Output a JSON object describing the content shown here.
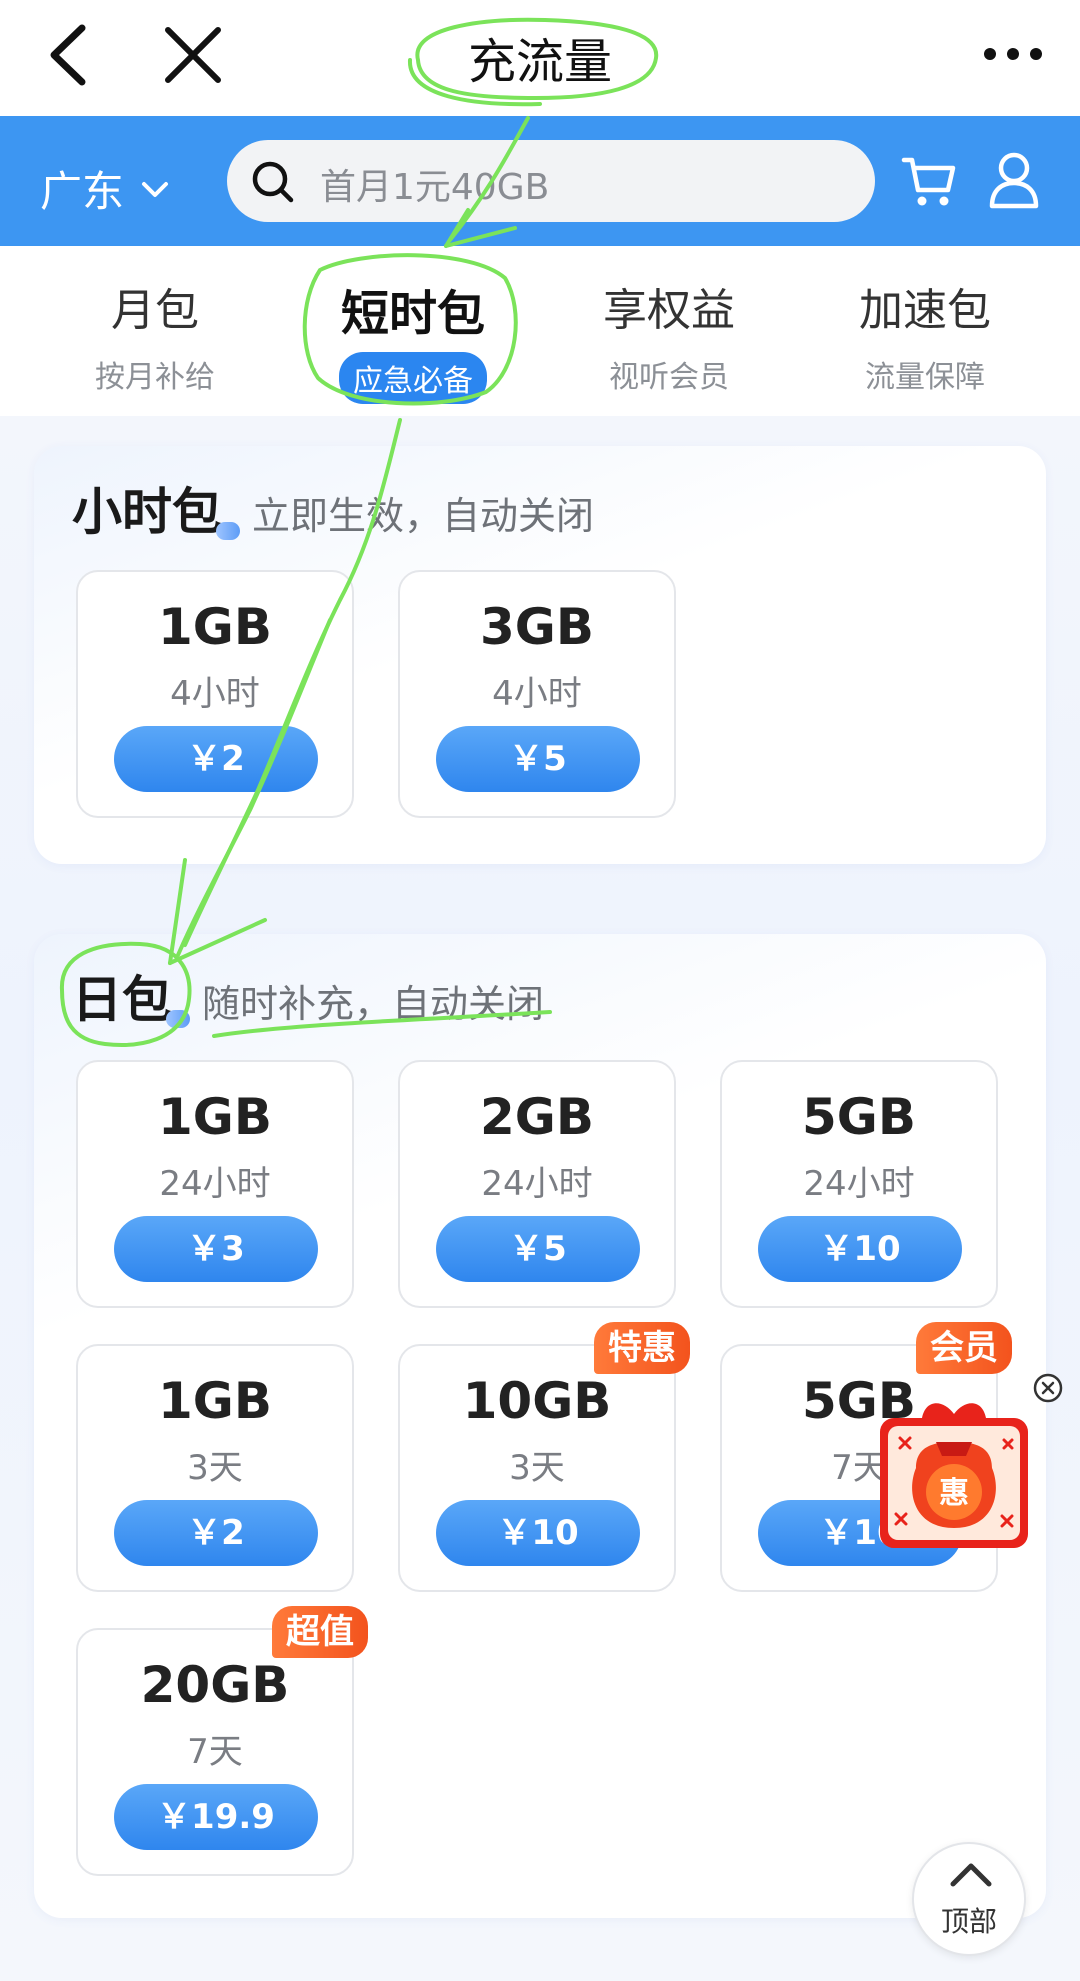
{
  "titlebar": {
    "title": "充流量",
    "back_icon": "chevron-left-icon",
    "close_icon": "close-icon",
    "more_icon": "more-dots-icon"
  },
  "searchbar": {
    "region": "广东",
    "placeholder": "首月1元40GB",
    "bg_color": "#3d96f2"
  },
  "tabs": [
    {
      "name": "月包",
      "sub": "按月补给"
    },
    {
      "name": "短时包",
      "sub": "应急必备",
      "active": true
    },
    {
      "name": "享权益",
      "sub": "视听会员"
    },
    {
      "name": "加速包",
      "sub": "流量保障"
    }
  ],
  "hour_section": {
    "title": "小时包",
    "desc": "立即生效，自动关闭",
    "cards": [
      {
        "gb": "1GB",
        "dur": "4小时",
        "price": "￥2"
      },
      {
        "gb": "3GB",
        "dur": "4小时",
        "price": "￥5"
      }
    ]
  },
  "day_section": {
    "title": "日包",
    "desc": "随时补充，自动关闭",
    "cards": [
      {
        "gb": "1GB",
        "dur": "24小时",
        "price": "￥3"
      },
      {
        "gb": "2GB",
        "dur": "24小时",
        "price": "￥5"
      },
      {
        "gb": "5GB",
        "dur": "24小时",
        "price": "￥10"
      },
      {
        "gb": "1GB",
        "dur": "3天",
        "price": "￥2"
      },
      {
        "gb": "10GB",
        "dur": "3天",
        "price": "￥10",
        "tag": "特惠"
      },
      {
        "gb": "5GB",
        "dur": "7天",
        "price": "￥10",
        "tag": "会员"
      },
      {
        "gb": "20GB",
        "dur": "7天",
        "price": "￥19.9",
        "tag": "超值"
      }
    ]
  },
  "promo": {
    "label": "惠"
  },
  "to_top": {
    "label": "顶部"
  },
  "colors": {
    "accent_blue": "#2f86ee",
    "tag_orange": "#f3531d",
    "annotation_green": "#7be35a"
  }
}
